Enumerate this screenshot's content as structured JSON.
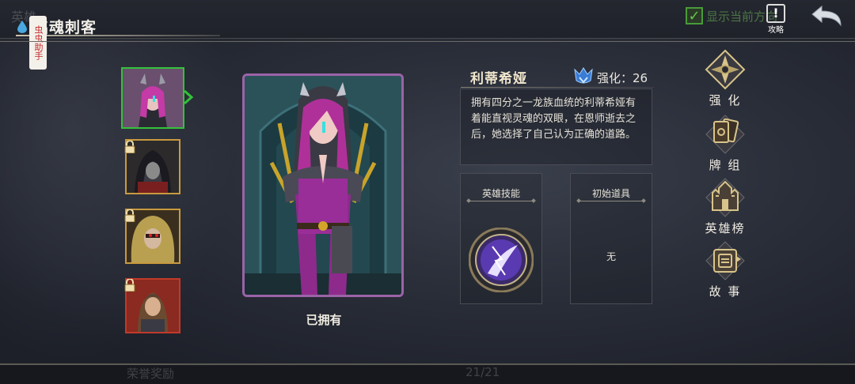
{
  "header": {
    "background_title": "英雄",
    "page_title": "铭魂刺客",
    "helper_tab": "虫虫助手",
    "show_current_label": "显示当前方向",
    "show_current_checked": true,
    "guide_label": "攻略"
  },
  "hero_list": [
    {
      "name": "利蒂希娅",
      "locked": false,
      "selected": true
    },
    {
      "name": "hero-2",
      "locked": true,
      "selected": false
    },
    {
      "name": "hero-3",
      "locked": true,
      "selected": false
    },
    {
      "name": "hero-4",
      "locked": true,
      "selected": false
    }
  ],
  "portrait": {
    "status": "已拥有"
  },
  "hero_info": {
    "name": "利蒂希娅",
    "enhance_label": "强化：26",
    "description": "拥有四分之一龙族血统的利蒂希娅有着能直视灵魂的双眼，在恩师逝去之后，她选择了自己认为正确的道路。",
    "skill_title": "英雄技能",
    "item_title": "初始道具",
    "item_value": "无"
  },
  "side_menu": [
    {
      "id": "enhance",
      "label": "强 化"
    },
    {
      "id": "deck",
      "label": "牌 组"
    },
    {
      "id": "ranking",
      "label": "英雄榜"
    },
    {
      "id": "story",
      "label": "故 事"
    }
  ],
  "footer": {
    "reward_label": "荣誉奖励",
    "page_count": "21/21"
  },
  "colors": {
    "selected_border": "#33c23a",
    "slot_border": "#c99a3e",
    "portrait_border": "#9b63a8",
    "accent_gold": "#d8c48a"
  }
}
